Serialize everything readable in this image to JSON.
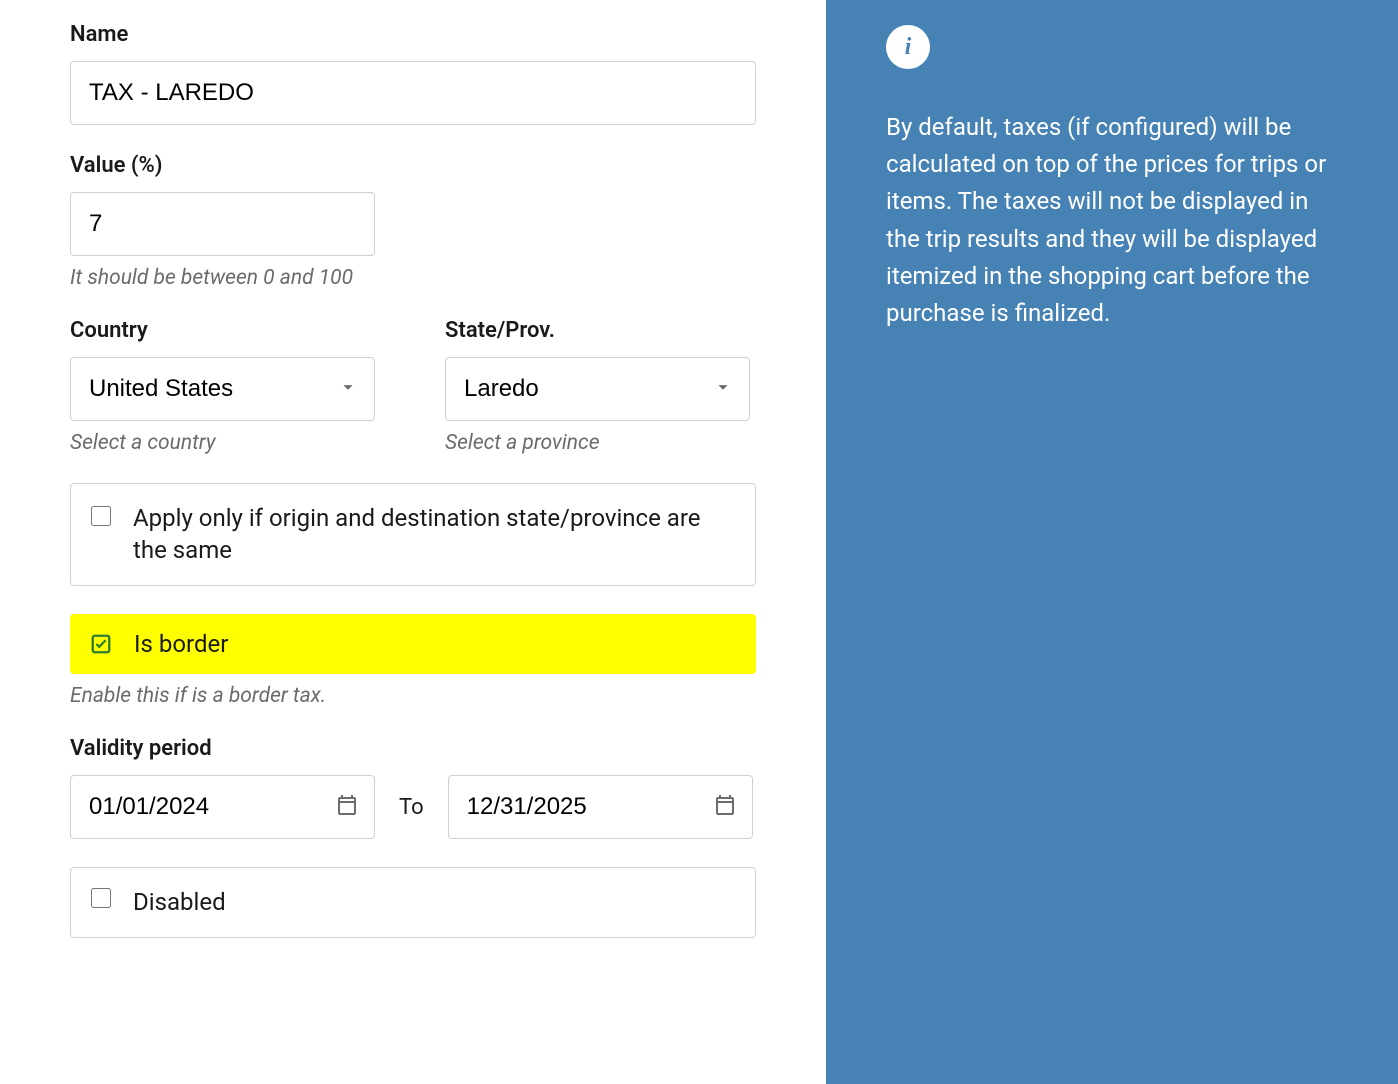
{
  "form": {
    "name": {
      "label": "Name",
      "value": "TAX - LAREDO"
    },
    "value": {
      "label": "Value (%)",
      "value": "7",
      "help": "It should be between 0 and 100"
    },
    "country": {
      "label": "Country",
      "value": "United States",
      "help": "Select a country"
    },
    "state": {
      "label": "State/Prov.",
      "value": "Laredo",
      "help": "Select a province"
    },
    "apply_same": {
      "label": "Apply only if origin and destination state/province are the same"
    },
    "is_border": {
      "label": "Is border",
      "help": "Enable this if is a border tax."
    },
    "validity": {
      "label": "Validity period",
      "from": "01/01/2024",
      "to_label": "To",
      "to": "12/31/2025"
    },
    "disabled": {
      "label": "Disabled"
    }
  },
  "sidebar": {
    "text": "By default, taxes (if configured) will be calculated on top of the prices for trips or items. The taxes will not be displayed in the trip results and they will be displayed itemized in the shopping cart before the purchase is finalized."
  }
}
